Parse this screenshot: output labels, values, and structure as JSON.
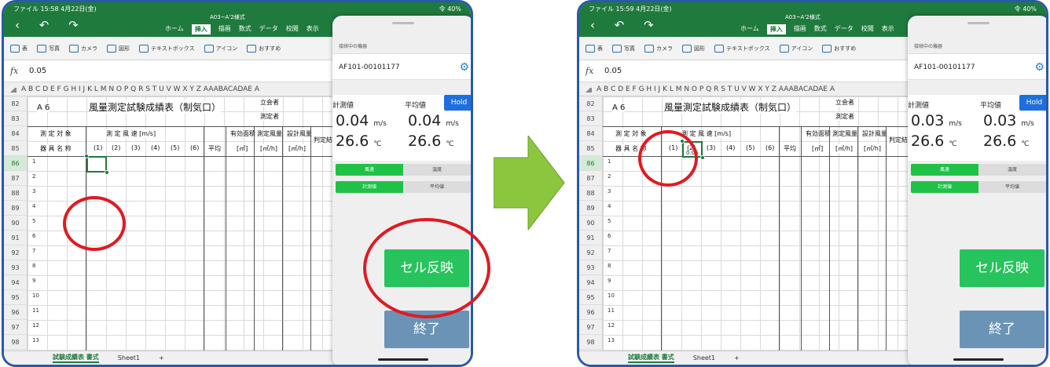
{
  "arrow_color": "#8cc63f",
  "accent_green": "#1f7a3d",
  "highlight_red": "#e01a22",
  "screens": [
    {
      "status_left": "ファイル  15:58  4月22日(金)",
      "status_right": "令 40%",
      "doc_title": "A03~A'2様式",
      "ribbon_tabs": [
        "ホーム",
        "挿入",
        "描画",
        "数式",
        "データ",
        "校閲",
        "表示"
      ],
      "active_tab": "挿入",
      "toolbar": [
        "表",
        "写真",
        "カメラ",
        "図形",
        "テキストボックス",
        "アイコン",
        "おすすめ"
      ],
      "formula_value": "0.05",
      "columns": "A B C D E F G H I J K L M N O P Q R S T U V W X Y Z AAABACADAE A",
      "rows": [
        "82",
        "83",
        "84",
        "85",
        "86",
        "87",
        "88",
        "89",
        "90",
        "91",
        "92",
        "93",
        "94",
        "95",
        "96",
        "97",
        "98"
      ],
      "sheet": {
        "cell_a6": "A 6",
        "title": "風量測定試験成績表（制気口）",
        "stand": "立会者",
        "measurer": "測定者",
        "target": "測 定 対 象",
        "speed": "測  定  風  速 [m/s]",
        "area": "有効面積",
        "meas_air": "測定風量",
        "design_air": "設計風量",
        "judge": "判定結果",
        "equip": "器 具 名 称",
        "c1": "(1)",
        "c2": "(2)",
        "c3": "(3)",
        "c4": "(4)",
        "c5": "(5)",
        "c6": "(6)",
        "avg": "平均",
        "unit_m2": "[㎡]",
        "unit_air": "[㎥/h]",
        "row_nums": [
          "1",
          "2",
          "3",
          "4",
          "5",
          "6",
          "7",
          "8",
          "9",
          "10",
          "11",
          "12",
          "13"
        ],
        "cell_value": ""
      },
      "sheet_tabs": [
        "試験成績表 書式",
        "Sheet1",
        "+"
      ],
      "panel": {
        "section_label": "接続中の機器",
        "device_id": "AF101-00101177",
        "measured_label": "計測値",
        "average_label": "平均値",
        "hold_label": "Hold",
        "speed_meas": "0.04",
        "speed_avg": "0.04",
        "speed_unit": "m/s",
        "temp_meas": "26.6",
        "temp_avg": "26.6",
        "temp_unit": "℃",
        "mode_a": "風速",
        "mode_b": "温度",
        "value_a": "計測値",
        "value_b": "平均値",
        "reflect_button": "セル反映",
        "end_button": "終了"
      }
    },
    {
      "status_left": "ファイル  15:59  4月22日(金)",
      "status_right": "令 40%",
      "doc_title": "A03~A'2様式",
      "ribbon_tabs": [
        "ホーム",
        "挿入",
        "描画",
        "数式",
        "データ",
        "校閲",
        "表示"
      ],
      "active_tab": "挿入",
      "toolbar": [
        "表",
        "写真",
        "カメラ",
        "図形",
        "テキストボックス",
        "アイコン",
        "おすすめ"
      ],
      "formula_value": "0.05",
      "columns": "A B C D E F G H I J K L M N O P Q R S T U V W X Y Z AAABACADAE A",
      "rows": [
        "82",
        "83",
        "84",
        "85",
        "86",
        "87",
        "88",
        "89",
        "90",
        "91",
        "92",
        "93",
        "94",
        "95",
        "96",
        "97",
        "98"
      ],
      "sheet": {
        "cell_a6": "A 6",
        "title": "風量測定試験成績表（制気口）",
        "stand": "立会者",
        "measurer": "測定者",
        "target": "測 定 対 象",
        "speed": "測  定  風  速 [m/s]",
        "area": "有効面積",
        "meas_air": "測定風量",
        "design_air": "設計風量",
        "judge": "判定結果",
        "equip": "器 具 名 称",
        "c1": "(1)",
        "c2": "(2)",
        "c3": "(3)",
        "c4": "(4)",
        "c5": "(5)",
        "c6": "(6)",
        "avg": "平均",
        "unit_m2": "[㎡]",
        "unit_air": "[㎥/h]",
        "row_nums": [
          "1",
          "2",
          "3",
          "4",
          "5",
          "6",
          "7",
          "8",
          "9",
          "10",
          "11",
          "12",
          "13"
        ],
        "cell_value": "0.05"
      },
      "sheet_tabs": [
        "試験成績表 書式",
        "Sheet1",
        "+"
      ],
      "panel": {
        "section_label": "接続中の機器",
        "device_id": "AF101-00101177",
        "measured_label": "計測値",
        "average_label": "平均値",
        "hold_label": "Hold",
        "speed_meas": "0.03",
        "speed_avg": "0.03",
        "speed_unit": "m/s",
        "temp_meas": "26.6",
        "temp_avg": "26.6",
        "temp_unit": "℃",
        "mode_a": "風速",
        "mode_b": "温度",
        "value_a": "計測値",
        "value_b": "平均値",
        "reflect_button": "セル反映",
        "end_button": "終了"
      }
    }
  ]
}
